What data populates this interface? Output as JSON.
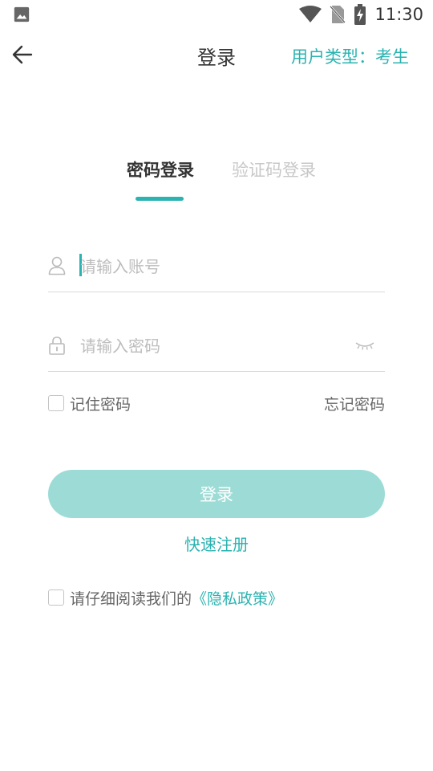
{
  "status_bar": {
    "time": "11:30",
    "icons": [
      "image-icon",
      "wifi-icon",
      "no-sim-icon",
      "battery-charging-icon"
    ]
  },
  "app_bar": {
    "title": "登录",
    "user_type": "用户类型：考生",
    "back_icon": "arrow-left-icon"
  },
  "tabs": {
    "password_login": "密码登录",
    "code_login": "验证码登录",
    "active": "password_login"
  },
  "form": {
    "account": {
      "value": "",
      "placeholder": "请输入账号",
      "icon": "user-icon"
    },
    "password": {
      "value": "",
      "placeholder": "请输入密码",
      "icon": "lock-icon",
      "toggle_icon": "eye-closed-icon"
    },
    "remember_password": "记住密码",
    "remember_checked": false,
    "forgot_password": "忘记密码",
    "login_button": "登录",
    "quick_register": "快速注册"
  },
  "privacy": {
    "prefix": "请仔细阅读我们的",
    "link": "《隐私政策》",
    "checked": false
  },
  "colors": {
    "accent": "#2ab3b0",
    "button_disabled": "#9ddcd6",
    "placeholder": "#bdbdbd"
  }
}
